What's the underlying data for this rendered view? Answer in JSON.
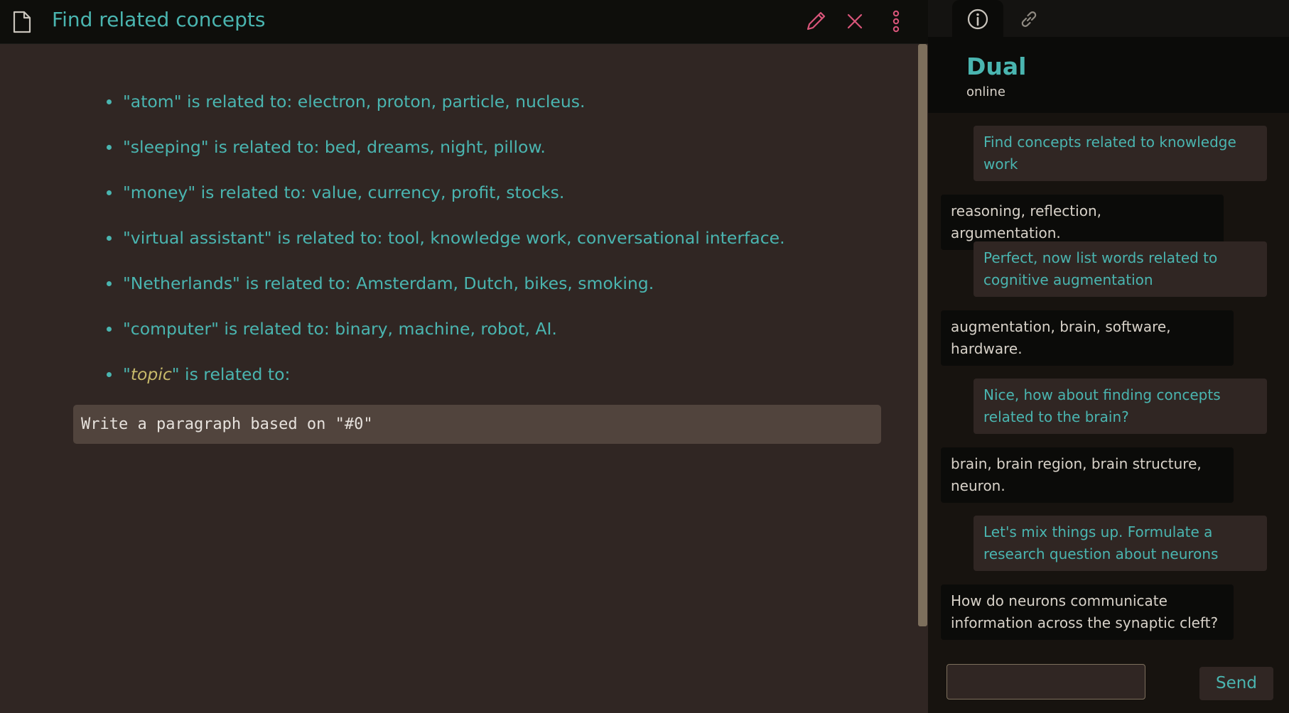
{
  "editor": {
    "title": "Find related concepts",
    "icons": {
      "document": "document-icon",
      "edit": "pencil-icon",
      "close": "close-icon",
      "more": "more-vertical-icon"
    },
    "bullets": [
      {
        "text": "\"atom\" is related to: electron, proton, particle, nucleus."
      },
      {
        "text": "\"sleeping\" is related to: bed, dreams, night, pillow."
      },
      {
        "text": "\"money\" is related to: value, currency, profit, stocks."
      },
      {
        "text": "\"virtual assistant\" is related to: tool, knowledge work, conversational interface."
      },
      {
        "text": "\"Netherlands\" is related to: Amsterdam, Dutch, bikes, smoking."
      },
      {
        "text": "\"computer\" is related to: binary, machine, robot, AI."
      }
    ],
    "last_bullet": {
      "open_quote": "\"",
      "placeholder": "topic",
      "rest": "\" is related to:"
    },
    "command": "Write a paragraph based on \"#0\""
  },
  "chat": {
    "tabs": {
      "info": "info-icon",
      "link": "link-icon"
    },
    "name": "Dual",
    "status": "online",
    "messages": [
      {
        "role": "user",
        "text": "Find concepts related to knowledge work"
      },
      {
        "role": "bot",
        "text": "reasoning, reflection, argumentation."
      },
      {
        "role": "user",
        "text": "Perfect, now list words related to cognitive augmentation"
      },
      {
        "role": "bot",
        "text": "augmentation, brain, software, hardware."
      },
      {
        "role": "user",
        "text": "Nice, how about finding concepts related to the brain?"
      },
      {
        "role": "bot",
        "text": "brain, brain region, brain structure, neuron."
      },
      {
        "role": "user",
        "text": "Let's mix things up. Formulate a research question about neurons"
      },
      {
        "role": "bot",
        "text": "How do neurons communicate information across the synaptic cleft?"
      }
    ],
    "input_value": "",
    "send_label": "Send"
  },
  "colors": {
    "accent": "#4ab5b0",
    "placeholder": "#c7b96a",
    "danger_icon": "#d9557a",
    "background": "#302623"
  }
}
